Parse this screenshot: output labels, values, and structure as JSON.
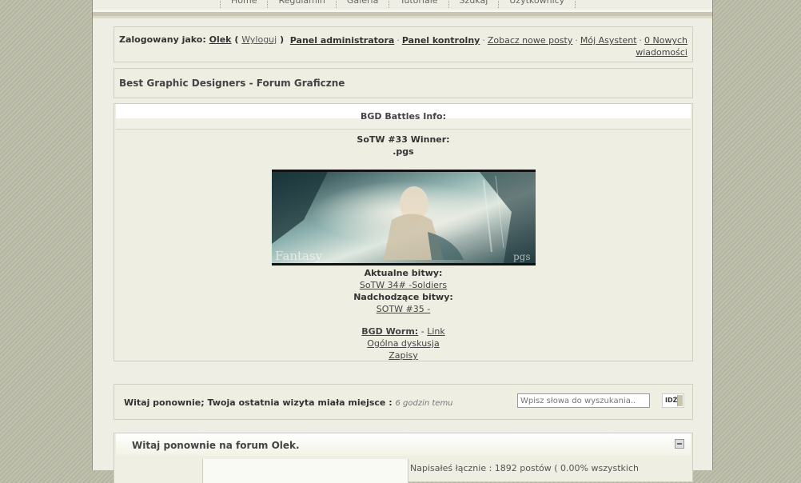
{
  "nav": {
    "items": [
      "Home",
      "Regulamin",
      "Galeria",
      "Tutoriale",
      "Szukaj",
      "Użytkownicy"
    ]
  },
  "userbar": {
    "logged_as": "Zalogowany jako:",
    "username": "Olek",
    "open_paren": "(",
    "logout": "Wyloguj",
    "close_paren": ")",
    "admin_panel": "Panel administratora",
    "control_panel": "Panel kontrolny",
    "new_posts": "Zobacz nowe posty",
    "assistant": "Mój Asystent",
    "messages": "0 Nowych wiadomości",
    "separator": "·"
  },
  "forum_title": "Best Graphic Designers - Forum Graficzne",
  "battles": {
    "header": "BGD Battles Info:",
    "winner_label": "SoTW #33 Winner:",
    "winner_name": ".pgs",
    "banner_left_text": "Fantasy",
    "banner_right_text": "pgs",
    "current_label": "Aktualne bitwy:",
    "current_link": "SoTW 34# -Soldiers",
    "upcoming_label": "Nadchodzące bitwy:",
    "upcoming_link": "SOTW #35 -",
    "worm_label": "BGD Worm:",
    "worm_dash": "-",
    "worm_link": "Link",
    "general": "Ogólna dyskusja",
    "signups": "Zapisy"
  },
  "welcome": {
    "message": "Witaj ponownie; Twoja ostatnia wizyta miała miejsce :",
    "time": "6 godzin temu",
    "search_placeholder": "Wpisz słowa do wyszukania..",
    "go_label": "IDŹ"
  },
  "forum_welcome": {
    "title": "Witaj ponownie na forum Olek.",
    "stats_text": "Napisałeś łącznie : 1892 postów ( 0.00% wszystkich"
  },
  "colors": {
    "outer_bg": "#b8b9a6",
    "page_bg": "#eeeee5",
    "link": "#444444"
  }
}
